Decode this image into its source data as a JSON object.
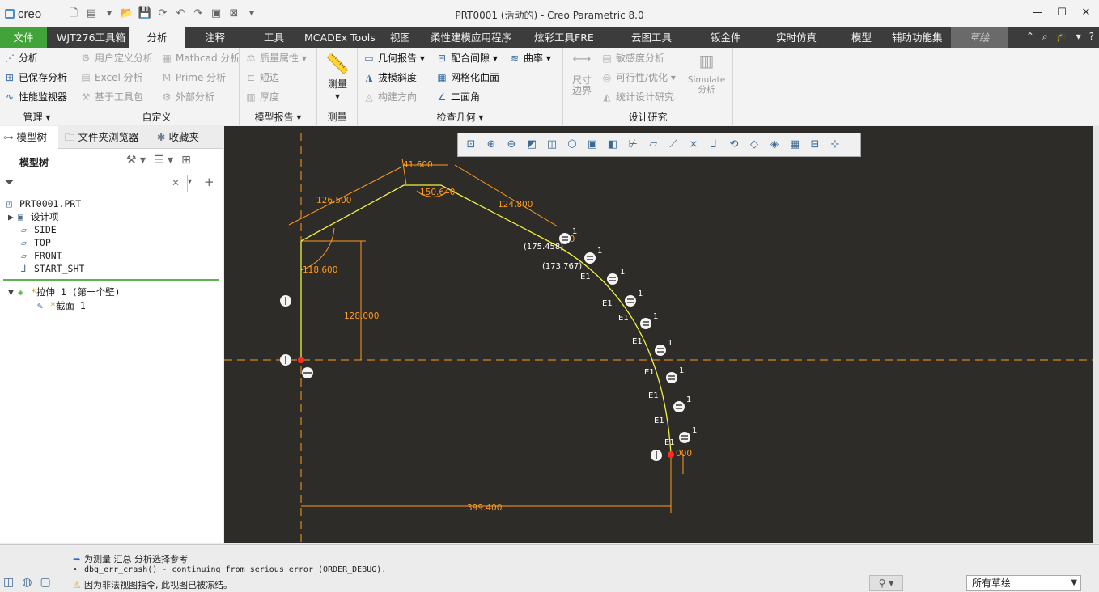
{
  "title_bar": {
    "logo": "creo",
    "window_title": "PRT0001 (活动的) - Creo Parametric 8.0",
    "quick_access": [
      "new-icon",
      "open-icon",
      "save-icon",
      "regenerate-icon",
      "undo-icon",
      "redo-icon",
      "windows-icon",
      "close-window-icon"
    ]
  },
  "tabs": [
    {
      "label": "文件"
    },
    {
      "label": "WJT276工具箱"
    },
    {
      "label": "分析"
    },
    {
      "label": "注释"
    },
    {
      "label": "工具"
    },
    {
      "label": "MCADEx Tools"
    },
    {
      "label": "视图"
    },
    {
      "label": "柔性建模应用程序"
    },
    {
      "label": "炫彩工具FRE"
    },
    {
      "label": "云图工具"
    },
    {
      "label": "钣金件"
    },
    {
      "label": "实时仿真"
    },
    {
      "label": "模型"
    },
    {
      "label": "辅助功能集"
    },
    {
      "label": "草绘"
    }
  ],
  "ribbon": {
    "manage": {
      "items": [
        "分析",
        "已保存分析",
        "性能监视器"
      ],
      "label": "管理"
    },
    "custom": {
      "items": [
        "用户定义分析",
        "Mathcad 分析",
        "Excel 分析",
        "Prime 分析",
        "基于工具包",
        "外部分析"
      ],
      "label": "自定义"
    },
    "model_report": {
      "items": [
        "质量属性",
        "短边",
        "厚度"
      ],
      "label": "模型报告"
    },
    "measure": {
      "button": "测量",
      "label": "测量"
    },
    "inspect_geometry": {
      "items": [
        "几何报告",
        "配合间隙",
        "曲率",
        "拔模斜度",
        "网格化曲面",
        "构建方向",
        "二面角"
      ],
      "label": "检查几何"
    },
    "design_study": {
      "items": [
        "敏感度分析",
        "可行性/优化",
        "统计设计研究"
      ],
      "dim_boundary": "尺寸边界",
      "simulate": "Simulate 分析",
      "label": "设计研究"
    }
  },
  "left_panel": {
    "nav_tabs": [
      "模型树",
      "文件夹浏览器",
      "收藏夹"
    ],
    "tree_title": "模型树",
    "filter_placeholder": "",
    "tree_items": [
      {
        "label": "PRT0001.PRT",
        "icon": "part-icon"
      },
      {
        "label": "设计项",
        "icon": "design-items-icon"
      },
      {
        "label": "SIDE",
        "icon": "datum-plane-icon"
      },
      {
        "label": "TOP",
        "icon": "datum-plane-icon"
      },
      {
        "label": "FRONT",
        "icon": "datum-plane-icon"
      },
      {
        "label": "START_SHT",
        "icon": "csys-icon"
      },
      {
        "label": "拉伸 1 (第一个壁)",
        "icon": "extrude-icon"
      },
      {
        "label": "截面 1",
        "icon": "section-icon"
      }
    ]
  },
  "sketch": {
    "dims": [
      "41.600",
      "126.500",
      "150.640",
      "124.800",
      "118.600",
      "128.000",
      "399.400",
      "(175.458)",
      "(173.767)",
      "80",
      "000"
    ],
    "equal_constraint": "1",
    "e1_label": "E1"
  },
  "status": {
    "line1": "为测量 汇总 分析选择参考",
    "line2": "dbg_err_crash() - continuing from serious error (ORDER_DEBUG).",
    "line3": "因为非法视图指令, 此视图已被冻结。",
    "filter": "所有草绘"
  },
  "colors": {
    "file_tab": "#43a33b",
    "graphics_bg": "#2d2c29",
    "sketch_line": "#f2f040",
    "dimension": "#ff9a1f",
    "point": "#ff2a2a"
  }
}
